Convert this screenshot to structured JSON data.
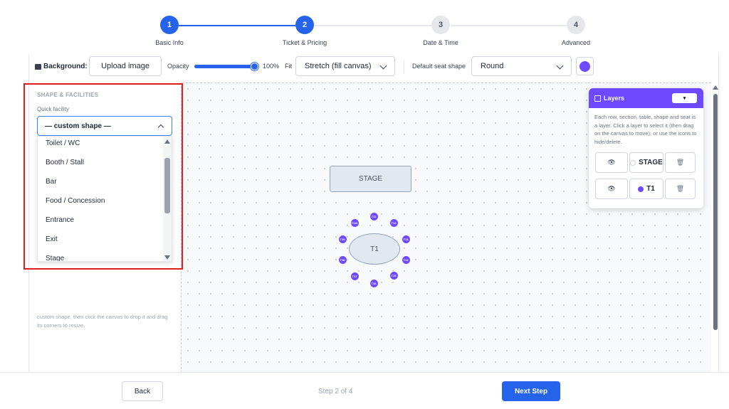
{
  "stepper": {
    "steps": [
      {
        "number": "1",
        "label": "Basic Info",
        "state": "completed"
      },
      {
        "number": "2",
        "label": "Ticket & Pricing",
        "state": "active"
      },
      {
        "number": "3",
        "label": "Date & Time",
        "state": "pending"
      },
      {
        "number": "4",
        "label": "Advanced",
        "state": "pending"
      }
    ]
  },
  "toolbar": {
    "background_label": "Background:",
    "upload_label": "Upload image",
    "opacity_label": "Opacity",
    "opacity_value": "100%",
    "opacity_fraction": 1.0,
    "fit_label": "Fit",
    "fit_value": "Stretch (fill canvas)",
    "seat_shape_label": "Default seat shape",
    "seat_shape_value": "Round",
    "seat_color": "#6d4aff"
  },
  "sidebar": {
    "section_title": "SHAPE & FACILITIES",
    "quick_facility_label": "Quick facility",
    "selected_facility": "— custom shape —",
    "dropdown_options": [
      "Toilet / WC",
      "Booth / Stall",
      "Bar",
      "Food / Concession",
      "Entrance",
      "Exit",
      "Stage"
    ],
    "help_text": "custom shape, then click the canvas to drop it and drag its corners to resize."
  },
  "canvas": {
    "stage_label": "STAGE",
    "table_label": "T1",
    "seats": [
      "T11",
      "T12",
      "T13",
      "T14",
      "T15",
      "T16",
      "T17",
      "T18",
      "T19",
      "T110"
    ]
  },
  "layers": {
    "title": "Layers",
    "toggle_label": "▾",
    "description": "Each row, section, table, shape and seat is a layer. Click a layer to select it (then drag on the canvas to move), or use the icons to hide/delete.",
    "items": [
      {
        "name": "STAGE"
      },
      {
        "name": "T1"
      }
    ]
  },
  "footer": {
    "back_label": "Back",
    "step_text": "Step 2 of 4",
    "next_label": "Next Step"
  },
  "colors": {
    "primary": "#2563eb",
    "accent": "#6d4aff",
    "highlight": "#e11d1d"
  }
}
